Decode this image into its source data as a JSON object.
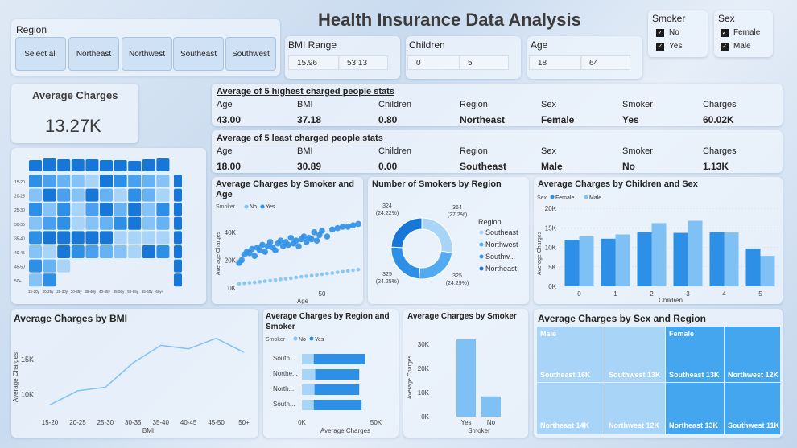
{
  "title": "Health Insurance Data Analysis",
  "region_slicer": {
    "label": "Region",
    "buttons": [
      "Select all",
      "Northeast",
      "Northwest",
      "Southeast",
      "Southwest"
    ]
  },
  "bmi_range": {
    "label": "BMI Range",
    "min": "15.96",
    "max": "53.13"
  },
  "children_range": {
    "label": "Children",
    "min": "0",
    "max": "5"
  },
  "age_range": {
    "label": "Age",
    "min": "18",
    "max": "64"
  },
  "smoker_slicer": {
    "label": "Smoker",
    "options": [
      "No",
      "Yes"
    ],
    "checked": [
      true,
      true
    ]
  },
  "sex_slicer": {
    "label": "Sex",
    "options": [
      "Female",
      "Male"
    ],
    "checked": [
      true,
      true
    ]
  },
  "kpi": {
    "label": "Average Charges",
    "value": "13.27K"
  },
  "heatmap": {
    "row_labels": [
      "15-20",
      "20-25",
      "25-30",
      "30-35",
      "35-40",
      "40-45",
      "45-50",
      "50+"
    ],
    "col_labels": [
      "15-20y",
      "20-25y",
      "25-30y",
      "30-35y",
      "35-40y",
      "40-45y",
      "45-50y",
      "50-55y",
      "55-60y",
      "60y+"
    ]
  },
  "highest": {
    "title": "Average of 5 highest charged people stats",
    "headers": [
      "Age",
      "BMI",
      "Children",
      "Region",
      "Sex",
      "Smoker",
      "Charges"
    ],
    "values": [
      "43.00",
      "37.18",
      "0.80",
      "Northeast",
      "Female",
      "Yes",
      "60.02K"
    ]
  },
  "least": {
    "title": "Average of 5 least charged people stats",
    "headers": [
      "Age",
      "BMI",
      "Children",
      "Region",
      "Sex",
      "Smoker",
      "Charges"
    ],
    "values": [
      "18.00",
      "30.89",
      "0.00",
      "Southeast",
      "Male",
      "No",
      "1.13K"
    ]
  },
  "colors": {
    "no": "#7fc1f5",
    "yes": "#2d8fe6",
    "dark": "#1677d9",
    "light": "#a8d4f7"
  },
  "chart_data": [
    {
      "type": "scatter",
      "title": "Average Charges by Smoker and Age",
      "legend_title": "Smoker",
      "legend": [
        "No",
        "Yes"
      ],
      "xlabel": "Age",
      "ylabel": "Average Charges",
      "xticks": [
        "50"
      ],
      "yticks": [
        "0K",
        "20K",
        "40K"
      ],
      "xlim": [
        18,
        64
      ],
      "ylim": [
        0,
        48000
      ],
      "series": [
        {
          "name": "No",
          "x": [
            18,
            20,
            22,
            24,
            26,
            28,
            30,
            32,
            34,
            36,
            38,
            40,
            42,
            44,
            46,
            48,
            50,
            52,
            54,
            56,
            58,
            60,
            62,
            64
          ],
          "y": [
            3000,
            3300,
            3700,
            4000,
            4400,
            4900,
            5300,
            5700,
            6200,
            6600,
            7000,
            7500,
            8000,
            8400,
            8900,
            9300,
            9800,
            10300,
            10700,
            11200,
            11700,
            12200,
            12700,
            13200
          ]
        },
        {
          "name": "Yes",
          "x": [
            18,
            19,
            20,
            21,
            22,
            23,
            24,
            25,
            26,
            27,
            28,
            29,
            30,
            31,
            32,
            33,
            34,
            35,
            36,
            37,
            38,
            39,
            40,
            41,
            42,
            43,
            44,
            45,
            46,
            47,
            48,
            49,
            50,
            52,
            54,
            56,
            58,
            60,
            62,
            64
          ],
          "y": [
            18000,
            20000,
            24000,
            26000,
            25000,
            28000,
            23000,
            29000,
            27000,
            31000,
            26000,
            30000,
            33000,
            29000,
            27000,
            32000,
            34000,
            30000,
            33000,
            31000,
            36000,
            32000,
            34000,
            30000,
            35000,
            37000,
            33000,
            36000,
            35000,
            40000,
            34000,
            38000,
            41000,
            37000,
            42000,
            43000,
            44000,
            44000,
            45000,
            46000
          ]
        }
      ]
    },
    {
      "type": "pie",
      "title": "Number of Smokers by Region",
      "legend_title": "Region",
      "categories": [
        "Southeast",
        "Northwest",
        "Southwest",
        "Northeast"
      ],
      "legend_display": [
        "Southeast",
        "Northwest",
        "Southw...",
        "Northeast"
      ],
      "values": [
        364,
        325,
        325,
        324
      ],
      "labels": [
        "364 (27.2%)",
        "325 (24.29%)",
        "325 (24.25%)",
        "324 (24.22%)"
      ]
    },
    {
      "type": "bar",
      "title": "Average Charges by Children and Sex",
      "legend_title": "Sex",
      "categories": [
        "0",
        "1",
        "2",
        "3",
        "4",
        "5"
      ],
      "xlabel": "Children",
      "ylabel": "Average Charges",
      "yticks": [
        "0K",
        "5K",
        "10K",
        "15K",
        "20K"
      ],
      "ylim": [
        0,
        20000
      ],
      "series": [
        {
          "name": "Female",
          "values": [
            11900,
            12200,
            13900,
            13700,
            13900,
            9700
          ]
        },
        {
          "name": "Male",
          "values": [
            12800,
            13300,
            16200,
            16800,
            13800,
            7800
          ]
        }
      ]
    },
    {
      "type": "line",
      "title": "Average Charges by BMI",
      "categories": [
        "15-20",
        "20-25",
        "25-30",
        "30-35",
        "35-40",
        "40-45",
        "45-50",
        "50+"
      ],
      "values": [
        8500,
        10500,
        11000,
        14500,
        17000,
        16500,
        18000,
        16000
      ],
      "xlabel": "BMI",
      "ylabel": "Average Charges",
      "yticks": [
        "10K",
        "15K"
      ],
      "ylim": [
        7500,
        19000
      ]
    },
    {
      "type": "bar",
      "orientation": "horizontal",
      "title": "Average Charges by Region and Smoker",
      "legend_title": "Smoker",
      "categories": [
        "South...",
        "Northe...",
        "North...",
        "South..."
      ],
      "xlabel": "Average Charges",
      "xticks": [
        "0K",
        "50K"
      ],
      "xlim": [
        0,
        50000
      ],
      "series": [
        {
          "name": "No",
          "values": [
            8000,
            9000,
            8500,
            8000
          ]
        },
        {
          "name": "Yes",
          "values": [
            34800,
            29700,
            30200,
            32300
          ]
        }
      ]
    },
    {
      "type": "bar",
      "title": "Average Charges by Smoker",
      "categories": [
        "Yes",
        "No"
      ],
      "values": [
        32000,
        8400
      ],
      "xlabel": "Smoker",
      "ylabel": "Average Charges",
      "yticks": [
        "0K",
        "10K",
        "20K",
        "30K"
      ],
      "ylim": [
        0,
        34000
      ]
    },
    {
      "type": "treemap",
      "title": "Average Charges by Sex and Region",
      "groups": [
        "Male",
        "Female"
      ],
      "items": [
        {
          "group": "Male",
          "label": "Southeast 16K"
        },
        {
          "group": "Male",
          "label": "Northeast 14K"
        },
        {
          "group": "Male",
          "label": "Southwest 13K"
        },
        {
          "group": "Male",
          "label": "Northwest 12K"
        },
        {
          "group": "Female",
          "label": "Southeast 13K"
        },
        {
          "group": "Female",
          "label": "Northeast 13K"
        },
        {
          "group": "Female",
          "label": "Northwest 12K"
        },
        {
          "group": "Female",
          "label": "Southwest 11K"
        }
      ]
    }
  ]
}
